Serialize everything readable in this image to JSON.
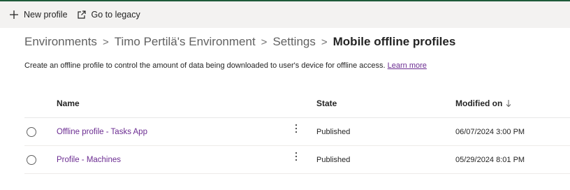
{
  "toolbar": {
    "new_profile_label": "New profile",
    "go_to_legacy_label": "Go to legacy"
  },
  "breadcrumb": {
    "items": [
      "Environments",
      "Timo Pertilä's Environment",
      "Settings"
    ],
    "separator": ">",
    "current": "Mobile offline profiles"
  },
  "description": {
    "text": "Create an offline profile to control the amount of data being downloaded to user's device for offline access.",
    "link_label": "Learn more"
  },
  "table": {
    "columns": {
      "name": "Name",
      "state": "State",
      "modified_on": "Modified on"
    },
    "sort": {
      "column": "modified_on",
      "direction": "descending",
      "icon": "arrow-down-icon"
    },
    "rows": [
      {
        "name": "Offline profile - Tasks App",
        "state": "Published",
        "modified_on": "06/07/2024 3:00 PM"
      },
      {
        "name": "Profile - Machines",
        "state": "Published",
        "modified_on": "05/29/2024 8:01 PM"
      }
    ]
  },
  "colors": {
    "accent_dark_green": "#1e5a3a",
    "link_purple": "#6b2c91",
    "command_bar_bg": "#f3f2f1",
    "text": "#242424"
  }
}
